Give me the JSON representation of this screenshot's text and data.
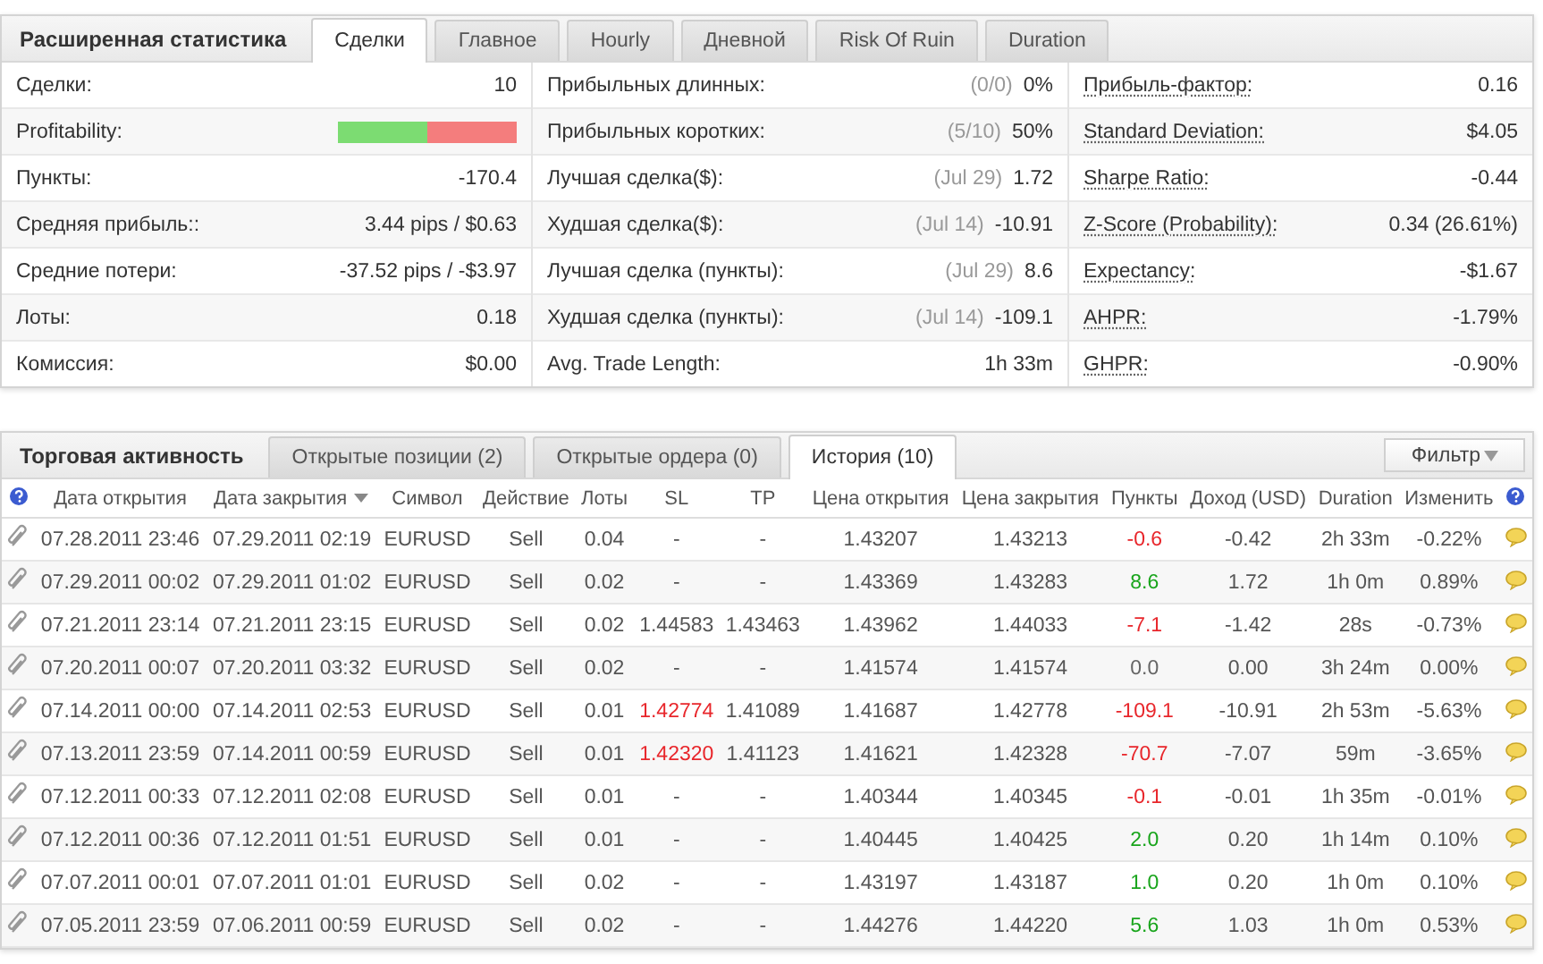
{
  "stats": {
    "title": "Расширенная статистика",
    "tabs": [
      {
        "label": "Сделки",
        "selected": true
      },
      {
        "label": "Главное",
        "selected": false
      },
      {
        "label": "Hourly",
        "selected": false
      },
      {
        "label": "Дневной",
        "selected": false
      },
      {
        "label": "Risk Of Ruin",
        "selected": false
      },
      {
        "label": "Duration",
        "selected": false
      }
    ],
    "columns": [
      {
        "dotted": false,
        "rows": [
          {
            "kind": "text",
            "label": "Сделки:",
            "value": "10"
          },
          {
            "kind": "bar",
            "label": "Profitability:",
            "level": 0.5
          },
          {
            "kind": "text",
            "label": "Пункты:",
            "value": "-170.4"
          },
          {
            "kind": "text",
            "label": "Средняя прибыль::",
            "value": "3.44 pips / $0.63"
          },
          {
            "kind": "text",
            "label": "Средние потери:",
            "value": "-37.52 pips / -$3.97"
          },
          {
            "kind": "text",
            "label": "Лоты:",
            "value": "0.18"
          },
          {
            "kind": "text",
            "label": "Комиссия:",
            "value": "$0.00"
          }
        ]
      },
      {
        "dotted": false,
        "rows": [
          {
            "kind": "text",
            "label": "Прибыльных длинных:",
            "note": "(0/0)",
            "value": "0%"
          },
          {
            "kind": "text",
            "label": "Прибыльных коротких:",
            "note": "(5/10)",
            "value": "50%"
          },
          {
            "kind": "text",
            "label": "Лучшая сделка($):",
            "note": "(Jul 29)",
            "value": "1.72"
          },
          {
            "kind": "text",
            "label": "Худшая сделка($):",
            "note": "(Jul 14)",
            "value": "-10.91"
          },
          {
            "kind": "text",
            "label": "Лучшая сделка (пункты):",
            "note": "(Jul 29)",
            "value": "8.6"
          },
          {
            "kind": "text",
            "label": "Худшая сделка (пункты):",
            "note": "(Jul 14)",
            "value": "-109.1"
          },
          {
            "kind": "text",
            "label": "Avg. Trade Length:",
            "value": "1h 33m"
          }
        ]
      },
      {
        "dotted": true,
        "rows": [
          {
            "kind": "text",
            "label": "Прибыль-фактор:",
            "value": "0.16"
          },
          {
            "kind": "text",
            "label": "Standard Deviation:",
            "value": "$4.05"
          },
          {
            "kind": "text",
            "label": "Sharpe Ratio:",
            "value": "-0.44"
          },
          {
            "kind": "text",
            "label": "Z-Score (Probability):",
            "value": "0.34 (26.61%)"
          },
          {
            "kind": "text",
            "label": "Expectancy:",
            "value": "-$1.67"
          },
          {
            "kind": "text",
            "label": "AHPR:",
            "value": "-1.79%"
          },
          {
            "kind": "text",
            "label": "GHPR:",
            "value": "-0.90%"
          }
        ]
      }
    ]
  },
  "trades": {
    "title": "Торговая активность",
    "tabs": [
      {
        "label": "Открытые позиции (2)",
        "selected": false
      },
      {
        "label": "Открытые ордера (0)",
        "selected": false
      },
      {
        "label": "История (10)",
        "selected": true
      }
    ],
    "filter_button": "Фильтр",
    "columns": [
      {
        "label": "Дата открытия",
        "sorted": false
      },
      {
        "label": "Дата закрытия",
        "sorted": true
      },
      {
        "label": "Символ",
        "sorted": false
      },
      {
        "label": "Действие",
        "sorted": false
      },
      {
        "label": "Лоты",
        "sorted": false
      },
      {
        "label": "SL",
        "sorted": false
      },
      {
        "label": "TP",
        "sorted": false
      },
      {
        "label": "Цена открытия",
        "sorted": false
      },
      {
        "label": "Цена закрытия",
        "sorted": false
      },
      {
        "label": "Пункты",
        "sorted": false
      },
      {
        "label": "Доход (USD)",
        "sorted": false
      },
      {
        "label": "Duration",
        "sorted": false
      },
      {
        "label": "Изменить",
        "sorted": false
      }
    ],
    "rows": [
      {
        "open": "07.28.2011 23:46",
        "close": "07.29.2011 02:19",
        "symbol": "EURUSD",
        "action": "Sell",
        "lots": "0.04",
        "sl": "-",
        "sl_hit": false,
        "tp": "-",
        "open_price": "1.43207",
        "close_price": "1.43213",
        "points": "-0.6",
        "color": "#e8262b",
        "income": "-0.42",
        "duration": "2h 33m",
        "change": "-0.22%"
      },
      {
        "open": "07.29.2011 00:02",
        "close": "07.29.2011 01:02",
        "symbol": "EURUSD",
        "action": "Sell",
        "lots": "0.02",
        "sl": "-",
        "sl_hit": false,
        "tp": "-",
        "open_price": "1.43369",
        "close_price": "1.43283",
        "points": "8.6",
        "color": "#19a51c",
        "income": "1.72",
        "duration": "1h 0m",
        "change": "0.89%"
      },
      {
        "open": "07.21.2011 23:14",
        "close": "07.21.2011 23:15",
        "symbol": "EURUSD",
        "action": "Sell",
        "lots": "0.02",
        "sl": "1.44583",
        "sl_hit": false,
        "tp": "1.43463",
        "open_price": "1.43962",
        "close_price": "1.44033",
        "points": "-7.1",
        "color": "#e8262b",
        "income": "-1.42",
        "duration": "28s",
        "change": "-0.73%"
      },
      {
        "open": "07.20.2011 00:07",
        "close": "07.20.2011 03:32",
        "symbol": "EURUSD",
        "action": "Sell",
        "lots": "0.02",
        "sl": "-",
        "sl_hit": false,
        "tp": "-",
        "open_price": "1.41574",
        "close_price": "1.41574",
        "points": "0.0",
        "color": "#666666",
        "income": "0.00",
        "duration": "3h 24m",
        "change": "0.00%"
      },
      {
        "open": "07.14.2011 00:00",
        "close": "07.14.2011 02:53",
        "symbol": "EURUSD",
        "action": "Sell",
        "lots": "0.01",
        "sl": "1.42774",
        "sl_hit": true,
        "tp": "1.41089",
        "open_price": "1.41687",
        "close_price": "1.42778",
        "points": "-109.1",
        "color": "#e8262b",
        "income": "-10.91",
        "duration": "2h 53m",
        "change": "-5.63%"
      },
      {
        "open": "07.13.2011 23:59",
        "close": "07.14.2011 00:59",
        "symbol": "EURUSD",
        "action": "Sell",
        "lots": "0.01",
        "sl": "1.42320",
        "sl_hit": true,
        "tp": "1.41123",
        "open_price": "1.41621",
        "close_price": "1.42328",
        "points": "-70.7",
        "color": "#e8262b",
        "income": "-7.07",
        "duration": "59m",
        "change": "-3.65%"
      },
      {
        "open": "07.12.2011 00:33",
        "close": "07.12.2011 02:08",
        "symbol": "EURUSD",
        "action": "Sell",
        "lots": "0.01",
        "sl": "-",
        "sl_hit": false,
        "tp": "-",
        "open_price": "1.40344",
        "close_price": "1.40345",
        "points": "-0.1",
        "color": "#e8262b",
        "income": "-0.01",
        "duration": "1h 35m",
        "change": "-0.01%"
      },
      {
        "open": "07.12.2011 00:36",
        "close": "07.12.2011 01:51",
        "symbol": "EURUSD",
        "action": "Sell",
        "lots": "0.01",
        "sl": "-",
        "sl_hit": false,
        "tp": "-",
        "open_price": "1.40445",
        "close_price": "1.40425",
        "points": "2.0",
        "color": "#19a51c",
        "income": "0.20",
        "duration": "1h 14m",
        "change": "0.10%"
      },
      {
        "open": "07.07.2011 00:01",
        "close": "07.07.2011 01:01",
        "symbol": "EURUSD",
        "action": "Sell",
        "lots": "0.02",
        "sl": "-",
        "sl_hit": false,
        "tp": "-",
        "open_price": "1.43197",
        "close_price": "1.43187",
        "points": "1.0",
        "color": "#19a51c",
        "income": "0.20",
        "duration": "1h 0m",
        "change": "0.10%"
      },
      {
        "open": "07.05.2011 23:59",
        "close": "07.06.2011 00:59",
        "symbol": "EURUSD",
        "action": "Sell",
        "lots": "0.02",
        "sl": "-",
        "sl_hit": false,
        "tp": "-",
        "open_price": "1.44276",
        "close_price": "1.44220",
        "points": "5.6",
        "color": "#19a51c",
        "income": "1.03",
        "duration": "1h 0m",
        "change": "0.53%"
      }
    ]
  }
}
